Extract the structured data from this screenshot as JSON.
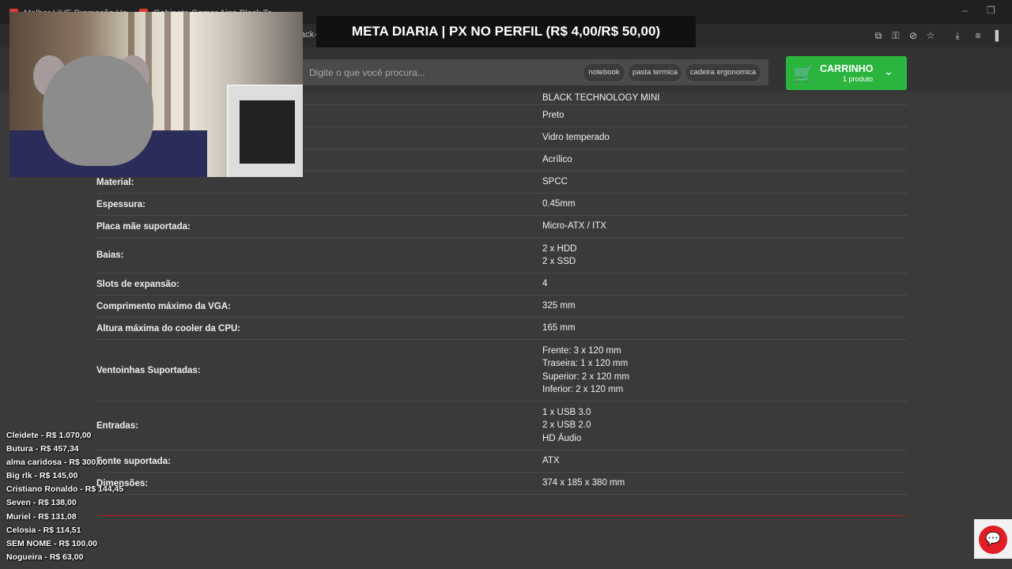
{
  "browser": {
    "tabs": [
      {
        "title": "Melhor LIVE Promoção Ha...",
        "color": "#e53935"
      },
      {
        "title": "Gabinete Gamer Aigo Black Te...",
        "color": "#e53935"
      }
    ],
    "url_fragment": "ack-t"
  },
  "banner": {
    "text": "META DIARIA | PX NO PERFIL (R$ 4,00/R$ 50,00)"
  },
  "search": {
    "placeholder": "Digite o que você procura...",
    "chips": [
      "notebook",
      "pasta termica",
      "cadeira ergonomica"
    ]
  },
  "cart": {
    "label": "CARRINHO",
    "count_label": "1 produto",
    "color": "#2bb53f"
  },
  "specs": [
    {
      "key": "",
      "value": [
        "BLACK TECHNOLOGY MINI"
      ]
    },
    {
      "key": "",
      "value": [
        "Preto"
      ]
    },
    {
      "key": "",
      "value": [
        "Vidro temperado"
      ]
    },
    {
      "key": "",
      "value": [
        "Acrílico"
      ]
    },
    {
      "key": "Material:",
      "value": [
        "SPCC"
      ]
    },
    {
      "key": "Espessura:",
      "value": [
        "0.45mm"
      ]
    },
    {
      "key": "Placa mãe suportada:",
      "value": [
        "Micro-ATX / ITX"
      ]
    },
    {
      "key": "Baias:",
      "value": [
        "2 x HDD",
        "2 x SSD"
      ]
    },
    {
      "key": "Slots de expansão:",
      "value": [
        "4"
      ]
    },
    {
      "key": "Comprimento máximo da VGA:",
      "value": [
        "325 mm"
      ]
    },
    {
      "key": "Altura máxima do cooler da CPU:",
      "value": [
        "165 mm"
      ]
    },
    {
      "key": "Ventoinhas Suportadas:",
      "value": [
        "Frente: 3 x 120 mm",
        "Traseira: 1 x 120 mm",
        "Superior: 2 x 120 mm",
        "Inferior: 2 x 120 mm"
      ]
    },
    {
      "key": "Entradas:",
      "value": [
        "1 x USB 3.0",
        "2 x USB 2.0",
        "HD Áudio"
      ]
    },
    {
      "key": "Fonte suportada:",
      "value": [
        "ATX"
      ]
    },
    {
      "key": "Dimensões:",
      "value": [
        "374 x 185 x 380 mm"
      ]
    }
  ],
  "donors": [
    "Cleidete - R$ 1.070,00",
    "Butura - R$ 457,34",
    "alma caridosa - R$ 300,00",
    "Big rlk - R$ 145,00",
    "Cristiano Ronaldo - R$ 144,45",
    "Seven - R$ 138,00",
    "Muriel - R$ 131,08",
    "Celosia - R$ 114,51",
    "SEM NOME - R$ 100,00",
    "Nogueira - R$ 63,00"
  ],
  "icons": {
    "cart": "shopping-cart-icon",
    "chevron": "chevron-down-icon",
    "chat": "chat-bubble-icon",
    "browser_toolbar": [
      "install-icon",
      "key-icon",
      "eye-off-icon",
      "star-icon",
      "download-icon",
      "menu-icon",
      "profile-icon"
    ]
  }
}
